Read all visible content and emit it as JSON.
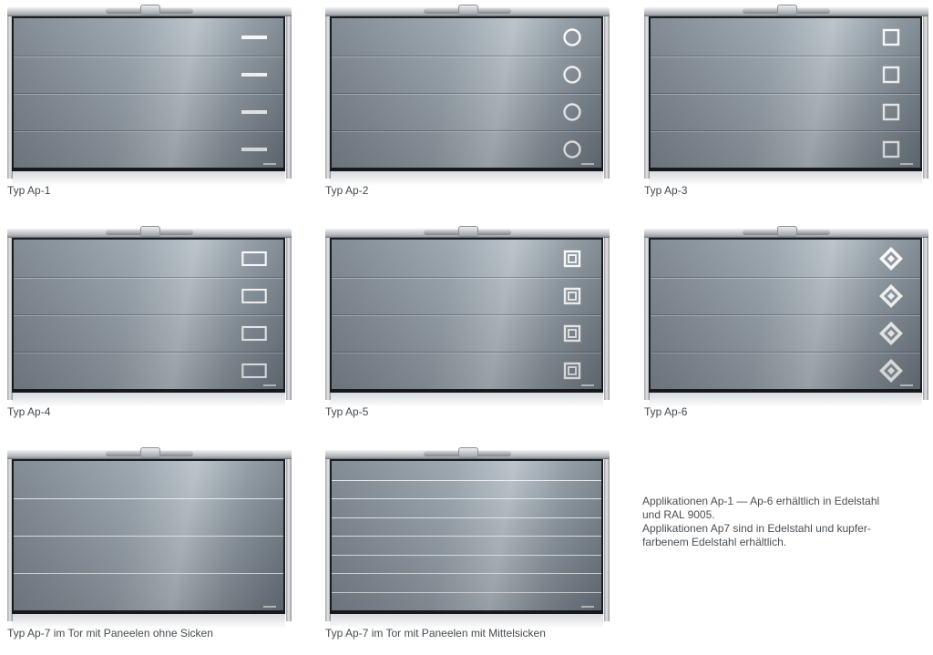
{
  "doors": [
    {
      "caption": "Typ Ap-1",
      "application": "bar-icon",
      "panel": "rows"
    },
    {
      "caption": "Typ Ap-2",
      "application": "circle-icon",
      "panel": "rows"
    },
    {
      "caption": "Typ Ap-3",
      "application": "square-icon",
      "panel": "rows"
    },
    {
      "caption": "Typ Ap-4",
      "application": "rectangle-icon",
      "panel": "rows"
    },
    {
      "caption": "Typ Ap-5",
      "application": "nested-square-icon",
      "panel": "rows"
    },
    {
      "caption": "Typ Ap-6",
      "application": "diamond-icon",
      "panel": "rows"
    },
    {
      "caption": "Typ Ap-7 im Tor mit Paneelen ohne Sicken",
      "application": "stripe-lines",
      "panel": "ohne-sicken"
    },
    {
      "caption": "Typ Ap-7 im Tor mit Paneelen mit Mittelsicken",
      "application": "stripe-lines",
      "panel": "mittelsicken"
    }
  ],
  "note": {
    "line1": "Applikationen Ap-1 — Ap-6 erhältlich in Edelstahl",
    "line2": "und RAL 9005.",
    "line3": "Applikationen Ap7 sind in Edelstahl und kupfer-",
    "line4": "farbenem Edelstahl erhältlich."
  },
  "colors": {
    "panel": "#9aa5ae",
    "frame": "#1b1d20",
    "application": "#ffffff",
    "caption": "#454a4f"
  }
}
